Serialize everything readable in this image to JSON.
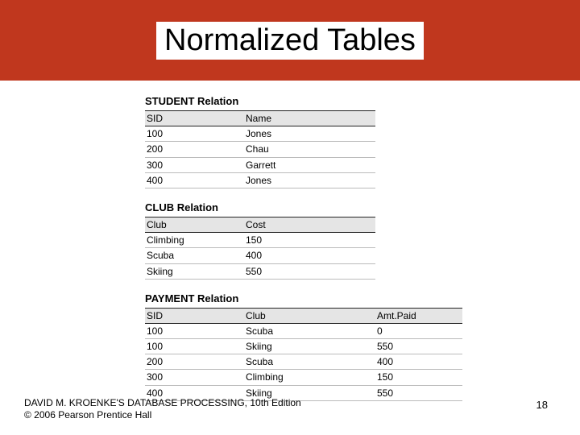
{
  "title": "Normalized Tables",
  "tables": {
    "student": {
      "name": "STUDENT Relation",
      "headers": [
        "SID",
        "Name"
      ],
      "rows": [
        [
          "100",
          "Jones"
        ],
        [
          "200",
          "Chau"
        ],
        [
          "300",
          "Garrett"
        ],
        [
          "400",
          "Jones"
        ]
      ]
    },
    "club": {
      "name": "CLUB Relation",
      "headers": [
        "Club",
        "Cost"
      ],
      "rows": [
        [
          "Climbing",
          "150"
        ],
        [
          "Scuba",
          "400"
        ],
        [
          "Skiing",
          "550"
        ]
      ]
    },
    "payment": {
      "name": "PAYMENT Relation",
      "headers": [
        "SID",
        "Club",
        "Amt.Paid"
      ],
      "rows": [
        [
          "100",
          "Scuba",
          "0"
        ],
        [
          "100",
          "Skiing",
          "550"
        ],
        [
          "200",
          "Scuba",
          "400"
        ],
        [
          "300",
          "Climbing",
          "150"
        ],
        [
          "400",
          "Skiing",
          "550"
        ]
      ]
    }
  },
  "footer": {
    "line1": "DAVID M. KROENKE'S DATABASE PROCESSING, 10th Edition",
    "line2": "© 2006 Pearson Prentice Hall"
  },
  "page_number": "18"
}
